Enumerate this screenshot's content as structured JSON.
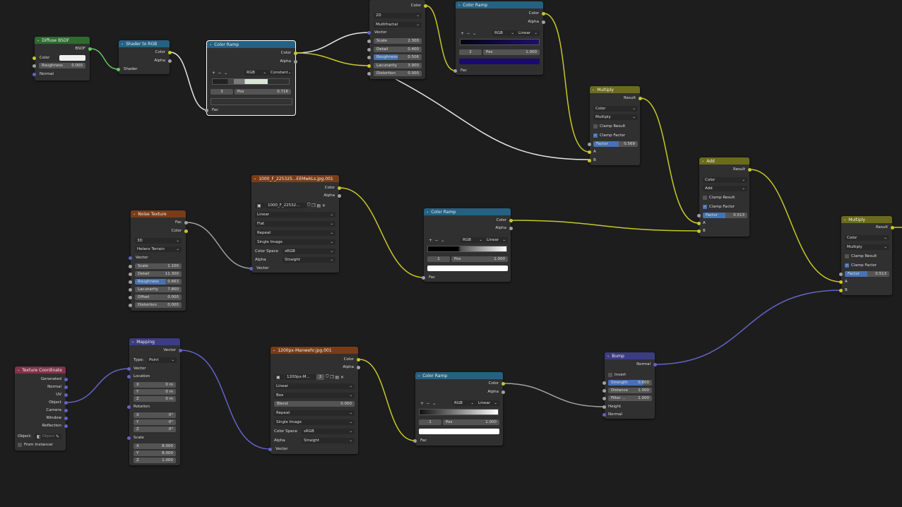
{
  "colors": {
    "shader": "#2f6b2f",
    "converter": "#246283",
    "texture": "#783d18",
    "vector": "#3c3c83",
    "input": "#83314a",
    "mix": "#6b6b1d",
    "wire_yellow": "#c7c729",
    "wire_grey": "#a1a1a1",
    "wire_purple": "#6363c7",
    "wire_green": "#63c763"
  },
  "diffuse": {
    "title": "Diffuse BSDF",
    "out": "BSDF",
    "color": "Color",
    "roughness_label": "Roughness",
    "roughness_value": "0.000",
    "normal": "Normal"
  },
  "shader2rgb": {
    "title": "Shader to RGB",
    "out_color": "Color",
    "out_alpha": "Alpha",
    "in_shader": "Shader"
  },
  "ramp1": {
    "title": "Color Ramp",
    "out_color": "Color",
    "out_alpha": "Alpha",
    "mode": "RGB",
    "interp": "Constant",
    "index": "3",
    "pos_label": "Pos",
    "pos_value": "0.716",
    "in_fac": "Fac"
  },
  "topnode": {
    "out_color": "Color",
    "dim": "2D",
    "type": "Multifractal",
    "in_vector": "Vector",
    "scale_label": "Scale",
    "scale": "2.300",
    "detail_label": "Detail",
    "detail": "0.400",
    "rough_label": "Roughness",
    "rough": "0.506",
    "lac_label": "Lacunarity",
    "lac": "3.900",
    "dist_label": "Distortion",
    "dist": "0.000",
    "rough_pct": 50
  },
  "ramp2": {
    "title": "Color Ramp",
    "out_color": "Color",
    "out_alpha": "Alpha",
    "mode": "RGB",
    "interp": "Linear",
    "index": "2",
    "pos_label": "Pos",
    "pos_value": "1.000",
    "in_fac": "Fac"
  },
  "multiply1": {
    "title": "Multiply",
    "out": "Result",
    "type": "Color",
    "op": "Multiply",
    "clamp_result": "Clamp Result",
    "clamp_factor": "Clamp Factor",
    "factor_label": "Factor",
    "factor_value": "0.569",
    "factor_pct": 57,
    "a": "A",
    "b": "B"
  },
  "add": {
    "title": "Add",
    "out": "Result",
    "type": "Color",
    "op": "Add",
    "clamp_result": "Clamp Result",
    "clamp_factor": "Clamp Factor",
    "factor_label": "Factor",
    "factor_value": "0.513",
    "factor_pct": 51,
    "a": "A",
    "b": "B"
  },
  "multiply2": {
    "title": "Multiply",
    "out": "Result",
    "type": "Color",
    "op": "Multiply",
    "clamp_result": "Clamp Result",
    "clamp_factor": "Clamp Factor",
    "factor_label": "Factor",
    "factor_value": "0.513",
    "factor_pct": 51,
    "a": "A",
    "b": "B"
  },
  "image1": {
    "title": "1000_F_225325...EEMwkLs.jpg.001",
    "out_color": "Color",
    "out_alpha": "Alpha",
    "image": "1000_F_22532...",
    "interp": "Linear",
    "proj": "Flat",
    "ext": "Repeat",
    "source": "Single Image",
    "cs_label": "Color Space",
    "cs": "sRGB",
    "alpha_label": "Alpha",
    "alpha": "Straight",
    "in_vector": "Vector"
  },
  "noise": {
    "title": "Noise Texture",
    "out_fac": "Fac",
    "out_color": "Color",
    "dim": "3D",
    "type": "Hetero Terrain",
    "in_vector": "Vector",
    "scale_label": "Scale",
    "scale": "1.100",
    "detail_label": "Detail",
    "detail": "11.300",
    "rough_label": "Roughness",
    "rough": "0.663",
    "lac_label": "Lacunarity",
    "lac": "7.800",
    "offset_label": "Offset",
    "offset": "0.000",
    "dist_label": "Distortion",
    "dist": "0.000",
    "rough_pct": 66
  },
  "ramp3": {
    "title": "Color Ramp",
    "out_color": "Color",
    "out_alpha": "Alpha",
    "mode": "RGB",
    "interp": "Linear",
    "index": "1",
    "pos_label": "Pos",
    "pos_value": "1.000",
    "in_fac": "Fac"
  },
  "texcoord": {
    "title": "Texture Coordinate",
    "generated": "Generated",
    "normal": "Normal",
    "uv": "UV",
    "object": "Object",
    "camera": "Camera",
    "window": "Window",
    "reflection": "Reflection",
    "object_label": "Object:",
    "object_placeholder": "Object",
    "from_instancer": "From Instancer"
  },
  "mapping": {
    "title": "Mapping",
    "out": "Vector",
    "type_label": "Type:",
    "type": "Point",
    "in_vector": "Vector",
    "location": "Location",
    "rotation": "Rotation",
    "scale": "Scale",
    "x": "X",
    "y": "Y",
    "z": "Z",
    "lx": "0 m",
    "ly": "0 m",
    "lz": "0 m",
    "rx": "0°",
    "ry": "0°",
    "rz": "0°",
    "sx": "8.000",
    "sy": "8.000",
    "sz": "1.000"
  },
  "image2": {
    "title": "1200px-Manwehr.jpg.001",
    "out_color": "Color",
    "out_alpha": "Alpha",
    "image": "1200px-M...",
    "users": "2",
    "interp": "Linear",
    "proj": "Box",
    "blend_label": "Blend",
    "blend": "0.000",
    "ext": "Repeat",
    "source": "Single Image",
    "cs_label": "Color Space",
    "cs": "sRGB",
    "alpha_label": "Alpha",
    "alpha": "Straight",
    "in_vector": "Vector"
  },
  "ramp4": {
    "title": "Color Ramp",
    "out_color": "Color",
    "out_alpha": "Alpha",
    "mode": "RGB",
    "interp": "Linear",
    "index": "1",
    "pos_label": "Pos",
    "pos_value": "1.000",
    "in_fac": "Fac"
  },
  "bump": {
    "title": "Bump",
    "out": "Normal",
    "invert": "Invert",
    "strength_label": "Strength",
    "strength": "0.800",
    "strength_pct": 80,
    "distance_label": "Distance",
    "distance": "1.000",
    "filter_label": "Filter ...",
    "filter": "1.000",
    "height": "Height",
    "normal": "Normal"
  }
}
